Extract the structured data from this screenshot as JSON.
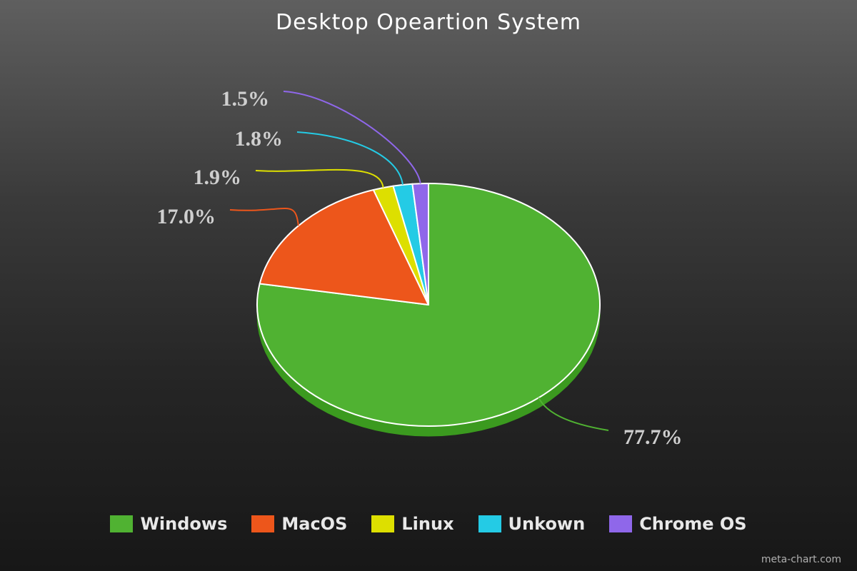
{
  "chart_data": {
    "type": "pie",
    "title": "Desktop Opeartion System",
    "slices": [
      {
        "name": "Windows",
        "value": 77.7,
        "label": "77.7%",
        "color": "#50b232",
        "shade": "#3b9a1f"
      },
      {
        "name": "MacOS",
        "value": 17.0,
        "label": "17.0%",
        "color": "#ed561b",
        "shade": "#c0440f"
      },
      {
        "name": "Linux",
        "value": 1.9,
        "label": "1.9%",
        "color": "#dddf00",
        "shade": "#b5b700"
      },
      {
        "name": "Unkown",
        "value": 1.8,
        "label": "1.8%",
        "color": "#24cbe5",
        "shade": "#1aa2b8"
      },
      {
        "name": "Chrome OS",
        "value": 1.5,
        "label": "1.5%",
        "color": "#8f67ea",
        "shade": "#6f4fc0"
      }
    ],
    "legend": "bottom",
    "start": "12 o'clock, clockwise"
  },
  "footer": {
    "credit": "meta-chart.com"
  }
}
